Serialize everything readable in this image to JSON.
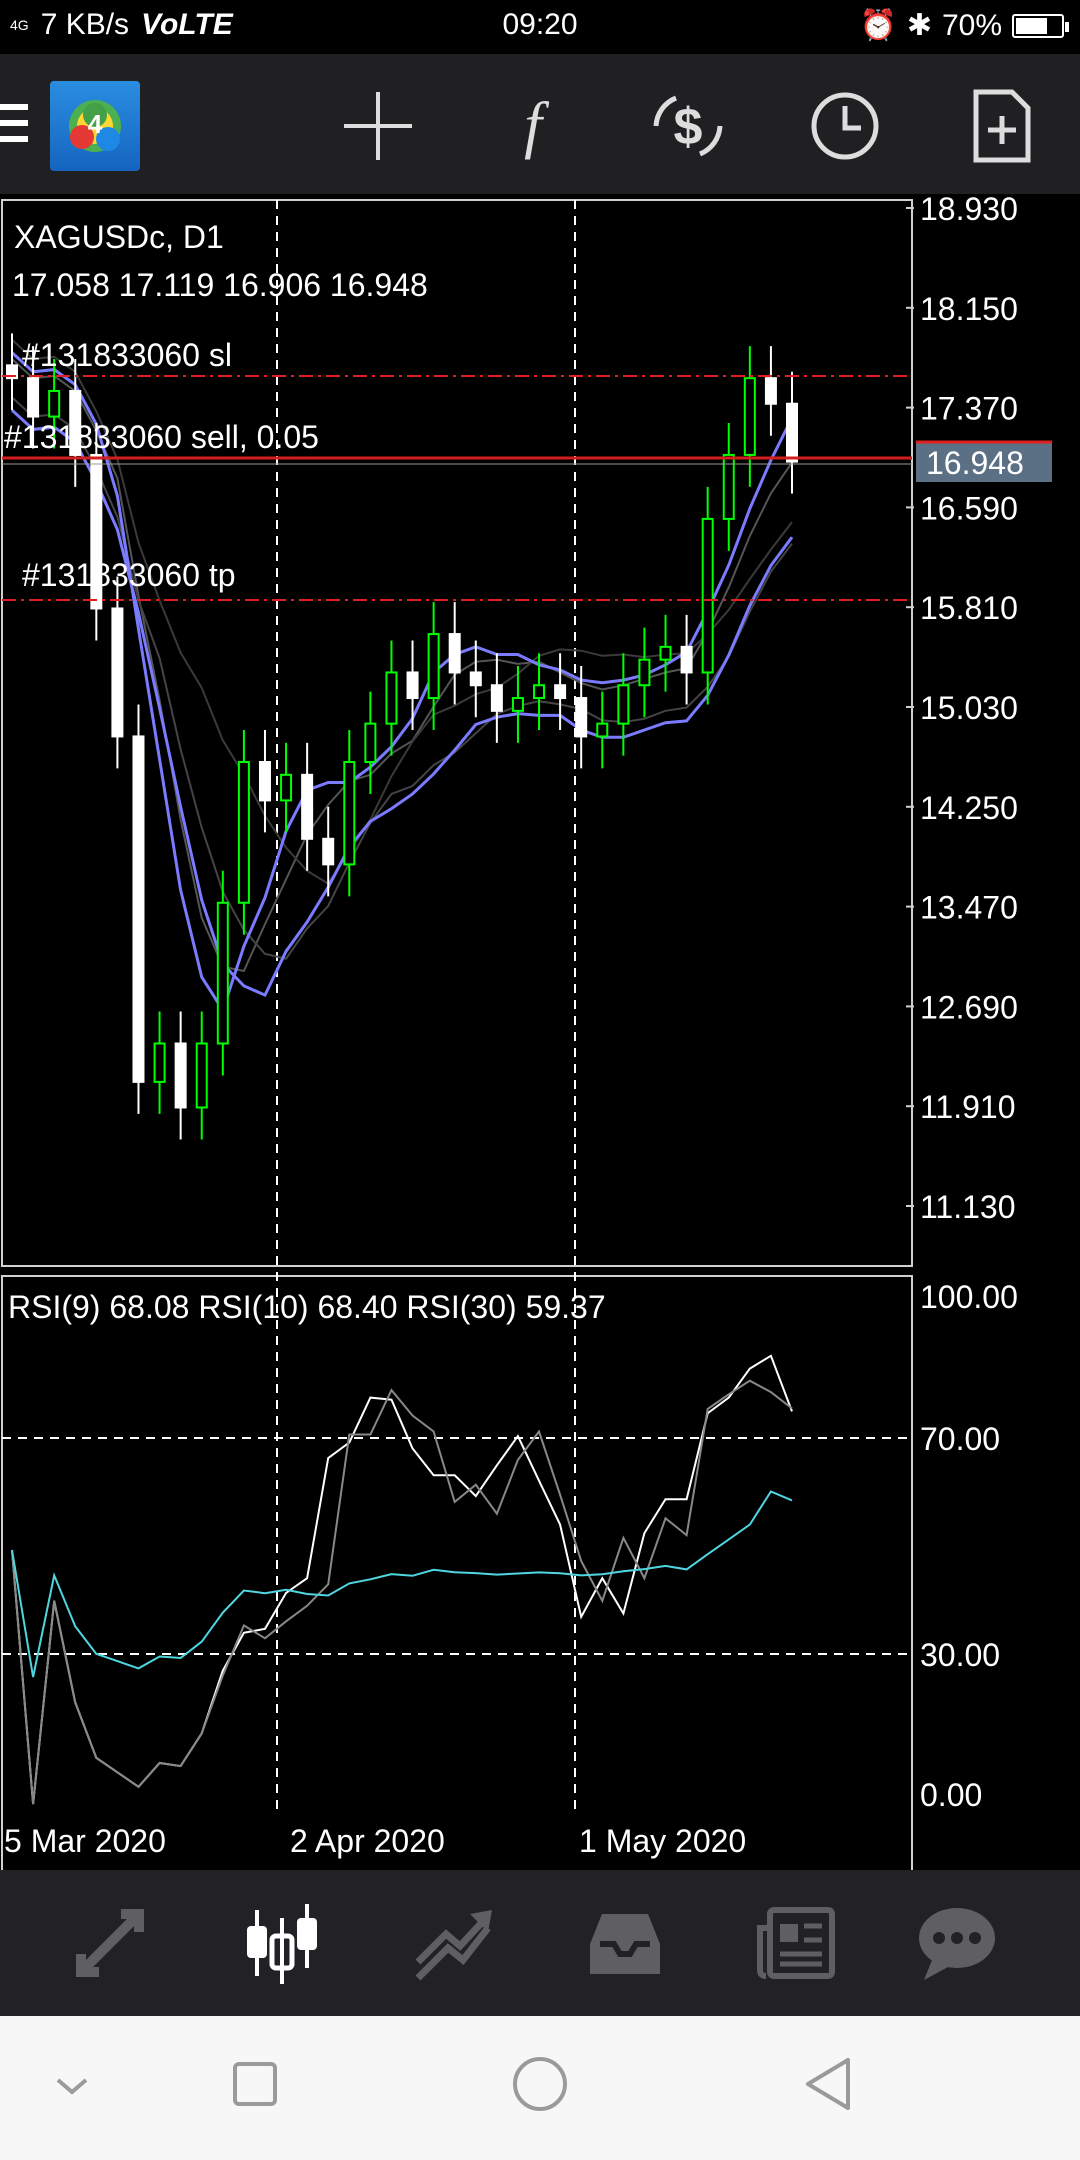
{
  "status_bar": {
    "signal": "4G",
    "speed": "7 KB/s",
    "volte": "VoLTE",
    "time": "09:20",
    "battery": "70%",
    "battery_level": 0.7
  },
  "toolbar": {
    "app_logo_icon": "metatrader-4-logo",
    "buttons": [
      "crosshair-icon",
      "function-icon",
      "trade-dollar-icon",
      "timeframe-clock-icon",
      "new-order-icon"
    ]
  },
  "chart": {
    "symbol_line": "XAGUSDc, D1",
    "ohlc_line": "17.058 17.119 16.906 16.948",
    "current_price": "16.948",
    "price_ticks": [
      "18.930",
      "18.150",
      "17.370",
      "16.590",
      "15.810",
      "15.030",
      "14.250",
      "13.470",
      "12.690",
      "11.910",
      "11.130"
    ],
    "order_lines": {
      "sl": "#131833060 sl",
      "sell": "#131833060 sell, 0.05",
      "tp": "#131833060 tp"
    },
    "date_labels": [
      "5 Mar 2020",
      "2 Apr 2020",
      "1 May 2020"
    ],
    "colors": {
      "bull": "#00ff00",
      "bear": "#ffffff",
      "ma": "#7b7bff",
      "sl_tp_line": "#e02020",
      "rsi_fast": "#ffffff",
      "rsi_slow": "#4fd6e0",
      "current_price_bg": "#5b6f85"
    }
  },
  "rsi": {
    "header": "RSI(9) 68.08 RSI(10) 68.40 RSI(30) 59.37",
    "ticks": [
      "100.00",
      "70.00",
      "30.00",
      "0.00"
    ]
  },
  "tab_bar": {
    "tabs": [
      "quotes-icon",
      "chart-icon",
      "trade-icon",
      "history-icon",
      "news-icon",
      "chat-icon"
    ],
    "active": "chart-icon"
  },
  "nav_bar": {
    "buttons": [
      "chevron-down-icon",
      "recents-icon",
      "home-icon",
      "back-icon"
    ]
  },
  "chart_data": {
    "type": "candlestick",
    "symbol": "XAGUSDc",
    "timeframe": "D1",
    "ylim": [
      10.7,
      19.1
    ],
    "x_labels": [
      "5 Mar 2020",
      "2 Apr 2020",
      "1 May 2020"
    ],
    "series": [
      {
        "name": "XAGUSDc",
        "values_close_approx": [
          17.6,
          17.3,
          17.5,
          17.0,
          15.8,
          14.8,
          12.1,
          12.4,
          11.9,
          12.4,
          13.5,
          14.6,
          14.3,
          14.5,
          14.0,
          13.8,
          14.6,
          14.9,
          15.3,
          15.1,
          15.6,
          15.3,
          15.2,
          15.0,
          15.1,
          15.2,
          15.1,
          14.8,
          14.9,
          15.2,
          15.4,
          15.5,
          15.3,
          16.5,
          17.0,
          17.6,
          17.4,
          16.948
        ]
      }
    ],
    "current_price": 16.948,
    "sl": 17.7,
    "sell": 16.96,
    "tp": 15.82
  }
}
